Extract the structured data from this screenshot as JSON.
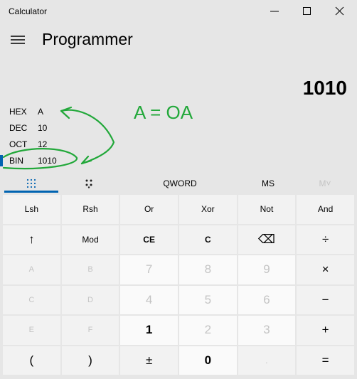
{
  "window": {
    "title": "Calculator"
  },
  "header": {
    "mode": "Programmer"
  },
  "display": {
    "value": "1010"
  },
  "radix": [
    {
      "label": "HEX",
      "value": "A"
    },
    {
      "label": "DEC",
      "value": "10"
    },
    {
      "label": "OCT",
      "value": "12"
    },
    {
      "label": "BIN",
      "value": "1010",
      "selected": true
    }
  ],
  "annotation": {
    "text": "A = OA",
    "color": "#22a83a"
  },
  "tabs": {
    "word": "QWORD",
    "ms": "MS",
    "mplus": "M˅"
  },
  "keys": [
    [
      "Lsh",
      "Rsh",
      "Or",
      "Xor",
      "Not",
      "And"
    ],
    [
      "↑",
      "Mod",
      "CE",
      "C",
      "⌫",
      "÷"
    ],
    [
      "A",
      "B",
      "7",
      "8",
      "9",
      "×"
    ],
    [
      "C",
      "D",
      "4",
      "5",
      "6",
      "−"
    ],
    [
      "E",
      "F",
      "1",
      "2",
      "3",
      "+"
    ],
    [
      "(",
      ")",
      "±",
      "0",
      ".",
      "="
    ]
  ],
  "accent": "#0063b1"
}
